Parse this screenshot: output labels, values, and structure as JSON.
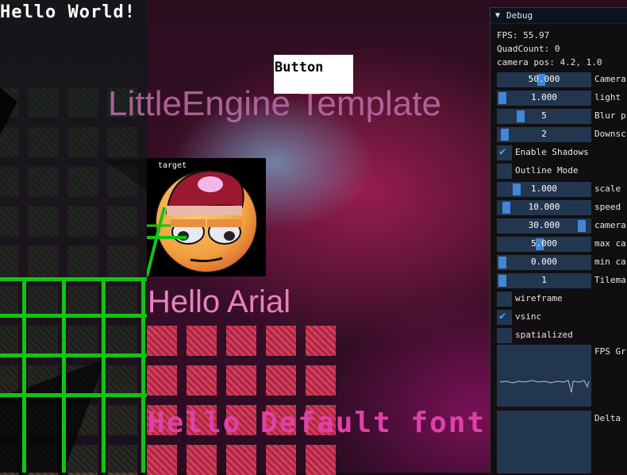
{
  "scene": {
    "hello_world": "Hello World!",
    "title": "LittleEngine Template",
    "button_label": "Button",
    "target_label": "target",
    "hello_arial": "Hello Arial",
    "hello_default": "Hello Default font"
  },
  "debug": {
    "title": "Debug",
    "fps": "FPS: 55.97",
    "quad_count": "QuadCount: 0",
    "camera_pos": "camera pos: 4.2, 1.0",
    "sliders": [
      {
        "value": "50.000",
        "label": "Camera",
        "level": 0.47
      },
      {
        "value": "1.000",
        "label": "light",
        "level": 0.0
      },
      {
        "value": "5",
        "label": "Blur p",
        "level": 0.22
      },
      {
        "value": "2",
        "label": "Downsc",
        "level": 0.03
      }
    ],
    "checkboxes_1": [
      {
        "label": "Enable Shadows",
        "checked": true
      },
      {
        "label": "Outline Mode",
        "checked": false
      }
    ],
    "sliders_2": [
      {
        "value": "1.000",
        "label": "scale",
        "level": 0.17
      },
      {
        "value": "10.000",
        "label": "speed",
        "level": 0.05
      },
      {
        "value": "30.000",
        "label": "camera",
        "level": 0.95
      },
      {
        "value": "5.000",
        "label": "max ca",
        "level": 0.45
      },
      {
        "value": "0.000",
        "label": "min ca",
        "level": 0.0
      },
      {
        "value": "1",
        "label": "Tilema",
        "level": 0.0
      }
    ],
    "checkboxes_2": [
      {
        "label": "wireframe",
        "checked": false
      },
      {
        "label": "vsinc",
        "checked": true
      },
      {
        "label": "spatialized",
        "checked": false
      }
    ],
    "plots": [
      {
        "label": "FPS Gr"
      },
      {
        "label": "Delta"
      }
    ],
    "colors": {
      "accent": "#4287d6",
      "frame": "#22364f",
      "check": "#4ea1ff"
    }
  }
}
